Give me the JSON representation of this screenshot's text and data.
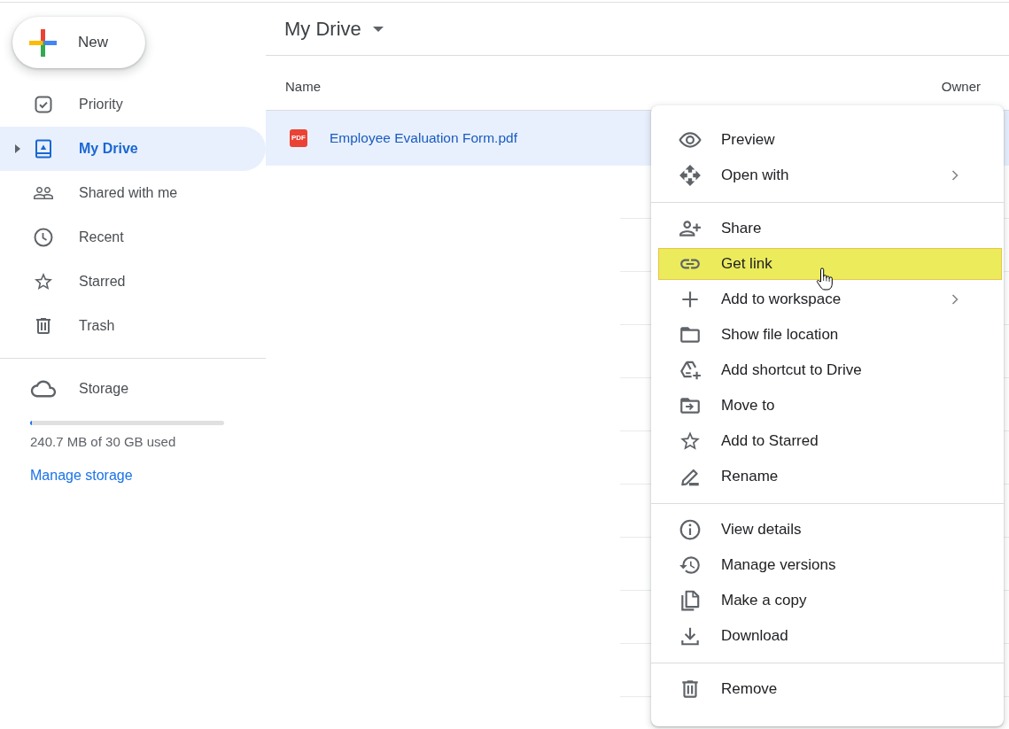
{
  "new_button": {
    "label": "New"
  },
  "nav": [
    {
      "label": "Priority",
      "selected": false,
      "expandable": false
    },
    {
      "label": "My Drive",
      "selected": true,
      "expandable": true
    },
    {
      "label": "Shared with me",
      "selected": false,
      "expandable": false
    },
    {
      "label": "Recent",
      "selected": false,
      "expandable": false
    },
    {
      "label": "Starred",
      "selected": false,
      "expandable": false
    },
    {
      "label": "Trash",
      "selected": false,
      "expandable": false
    }
  ],
  "storage": {
    "label": "Storage",
    "level": 0.008,
    "usage": "240.7 MB of 30 GB used",
    "link": "Manage storage"
  },
  "header": {
    "title": "My Drive"
  },
  "table": {
    "columns": [
      "Name",
      "Owner"
    ],
    "rows": [
      {
        "name": "Employee Evaluation Form.pdf",
        "file_type": "PDF",
        "selected": true
      }
    ]
  },
  "context_menu": {
    "groups": [
      {
        "items": [
          {
            "label": "Preview",
            "highlighted": false,
            "has_submenu": false
          },
          {
            "label": "Open with",
            "highlighted": false,
            "has_submenu": true
          }
        ]
      },
      {
        "items": [
          {
            "label": "Share",
            "highlighted": false,
            "has_submenu": false
          },
          {
            "label": "Get link",
            "highlighted": true,
            "has_submenu": false
          },
          {
            "label": "Add to workspace",
            "highlighted": false,
            "has_submenu": true
          },
          {
            "label": "Show file location",
            "highlighted": false,
            "has_submenu": false
          },
          {
            "label": "Add shortcut to Drive",
            "highlighted": false,
            "has_submenu": false
          },
          {
            "label": "Move to",
            "highlighted": false,
            "has_submenu": false
          },
          {
            "label": "Add to Starred",
            "highlighted": false,
            "has_submenu": false
          },
          {
            "label": "Rename",
            "highlighted": false,
            "has_submenu": false
          }
        ]
      },
      {
        "items": [
          {
            "label": "View details",
            "highlighted": false,
            "has_submenu": false
          },
          {
            "label": "Manage versions",
            "highlighted": false,
            "has_submenu": false
          },
          {
            "label": "Make a copy",
            "highlighted": false,
            "has_submenu": false
          },
          {
            "label": "Download",
            "highlighted": false,
            "has_submenu": false
          }
        ]
      },
      {
        "items": [
          {
            "label": "Remove",
            "highlighted": false,
            "has_submenu": false
          }
        ]
      }
    ]
  }
}
